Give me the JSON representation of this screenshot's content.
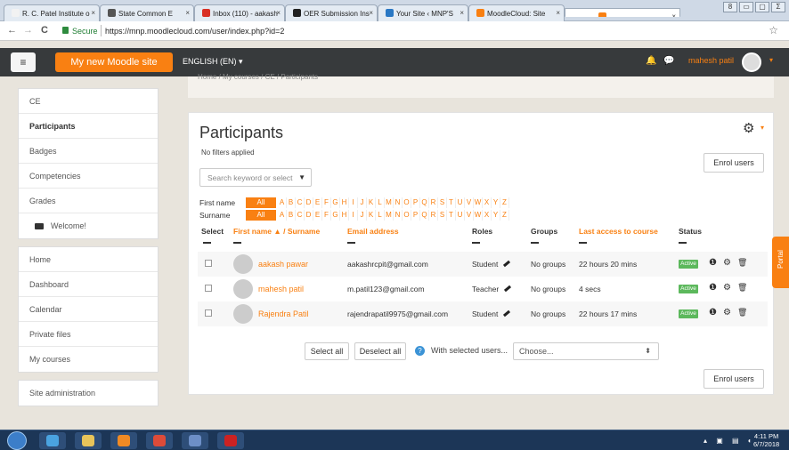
{
  "browser": {
    "tabs": [
      {
        "title": "R. C. Patel Institute o",
        "color": "#f2f2f2"
      },
      {
        "title": "State Common E",
        "color": "#555555"
      },
      {
        "title": "Inbox (110) - aakash",
        "color": "#d93025"
      },
      {
        "title": "OER Submission Ins",
        "color": "#222222"
      },
      {
        "title": "Your Site ‹ MNP'S",
        "color": "#2a78c4"
      },
      {
        "title": "MoodleCloud: Site",
        "color": "#f98012"
      },
      {
        "title": "CE: Participants",
        "color": "#f98012"
      }
    ],
    "close_glyph": "×",
    "window_controls": [
      "8",
      "▭",
      "▢",
      "Σ"
    ],
    "back": "←",
    "forward": "→",
    "reload": "C",
    "secure_label": "Secure",
    "url": "https://mnp.moodlecloud.com/user/index.php?id=2",
    "star": "☆"
  },
  "navbar": {
    "menu_glyph": "≡",
    "site_name": "My new Moodle site",
    "language": "ENGLISH (EN) ▾",
    "bell": "🔔",
    "chat": "💬",
    "user_name": "mahesh patil",
    "caret": "▾"
  },
  "breadcrumb": "Home / My courses / CE / Participants",
  "sidebar": {
    "block1": [
      {
        "label": "CE",
        "bold": false
      },
      {
        "label": "Participants",
        "bold": true
      },
      {
        "label": "Badges",
        "bold": false
      },
      {
        "label": "Competencies",
        "bold": false
      },
      {
        "label": "Grades",
        "bold": false
      },
      {
        "label": "Welcome!",
        "bold": false,
        "folder": true
      }
    ],
    "block2": [
      "Home",
      "Dashboard",
      "Calendar",
      "Private files",
      "My courses"
    ],
    "block3": [
      "Site administration"
    ]
  },
  "main": {
    "title": "Participants",
    "no_filters": "No filters applied",
    "gear": "⚙",
    "gear_caret": "▾",
    "enrol_label": "Enrol users",
    "search_placeholder": "Search keyword or select",
    "search_arrow": "▼",
    "first_name_label": "First name",
    "surname_label": "Surname",
    "all_label": "All",
    "letters": [
      "A",
      "B",
      "C",
      "D",
      "E",
      "F",
      "G",
      "H",
      "I",
      "J",
      "K",
      "L",
      "M",
      "N",
      "O",
      "P",
      "Q",
      "R",
      "S",
      "T",
      "U",
      "V",
      "W",
      "X",
      "Y",
      "Z"
    ],
    "columns": {
      "select": "Select",
      "name": "First name ▲ / Surname",
      "email": "Email address",
      "roles": "Roles",
      "groups": "Groups",
      "last_access": "Last access to course",
      "status": "Status"
    },
    "rows": [
      {
        "name": "aakash pawar",
        "email": "aakashrcpit@gmail.com",
        "role": "Student",
        "groups": "No groups",
        "last_access": "22 hours 20 mins",
        "status": "Active"
      },
      {
        "name": "mahesh patil",
        "email": "m.patil123@gmail.com",
        "role": "Teacher",
        "groups": "No groups",
        "last_access": "4 secs",
        "status": "Active"
      },
      {
        "name": "Rajendra Patil",
        "email": "rajendrapatil9975@gmail.com",
        "role": "Student",
        "groups": "No groups",
        "last_access": "22 hours 17 mins",
        "status": "Active"
      }
    ],
    "row_icons": {
      "info": "❶",
      "settings": "⚙",
      "delete": "🗑"
    },
    "select_all": "Select all",
    "deselect_all": "Deselect all",
    "help": "?",
    "with_selected": "With selected users...",
    "choose": "Choose...",
    "choose_arrow": "⬍"
  },
  "portal_label": "Portal",
  "taskbar": {
    "apps": [
      {
        "name": "ie-icon",
        "color": "#4aa3e0"
      },
      {
        "name": "explorer-icon",
        "color": "#e8c45a"
      },
      {
        "name": "media-player-icon",
        "color": "#f08a24"
      },
      {
        "name": "chrome-icon",
        "color": "#dd4b39"
      },
      {
        "name": "word-icon",
        "color": "#6d8fc7"
      },
      {
        "name": "acrobat-icon",
        "color": "#cc2222"
      }
    ],
    "tray": "▴ ▣ ▤ ◐",
    "time": "4:11 PM",
    "date": "6/7/2018"
  }
}
